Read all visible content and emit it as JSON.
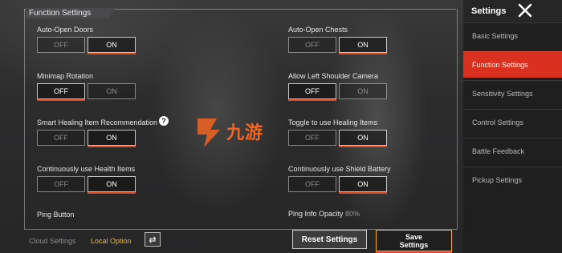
{
  "section_title": "Function Settings",
  "toggle_off": "OFF",
  "toggle_on": "ON",
  "options": [
    {
      "label": "Auto-Open Doors",
      "value": "ON"
    },
    {
      "label": "Auto-Open Chests",
      "value": "ON"
    },
    {
      "label": "Minimap Rotation",
      "value": "OFF"
    },
    {
      "label": "Allow Left Shoulder Camera",
      "value": "OFF"
    },
    {
      "label": "Smart Healing Item Recommendation",
      "value": "ON"
    },
    {
      "label": "Toggle to use Healing Items",
      "value": "ON"
    },
    {
      "label": "Continuously use Health Items",
      "value": "ON"
    },
    {
      "label": "Continuously use Shield Battery",
      "value": "ON"
    }
  ],
  "ping_button_label": "Ping Button",
  "ping_opacity": {
    "label": "Ping Info Opacity",
    "value": "80%"
  },
  "footer": {
    "cloud_settings": "Cloud Settings",
    "local_option": "Local Option",
    "reset_label": "Reset Settings",
    "save_label": "Save Settings"
  },
  "watermark_text": "九游",
  "sidebar": {
    "title": "Settings",
    "items": [
      {
        "label": "Basic Settings",
        "active": false
      },
      {
        "label": "Function Settings",
        "active": true
      },
      {
        "label": "Sensitivity Settings",
        "active": false
      },
      {
        "label": "Control Settings",
        "active": false
      },
      {
        "label": "Battle Feedback",
        "active": false
      },
      {
        "label": "Pickup Settings",
        "active": false
      }
    ]
  },
  "colors": {
    "accent": "#e0461f",
    "sidebar_active": "#d9301f",
    "save_border": "#f0b419",
    "local_option": "#e7b934"
  },
  "icons": [
    "help-icon",
    "swap-icon",
    "close-icon"
  ]
}
